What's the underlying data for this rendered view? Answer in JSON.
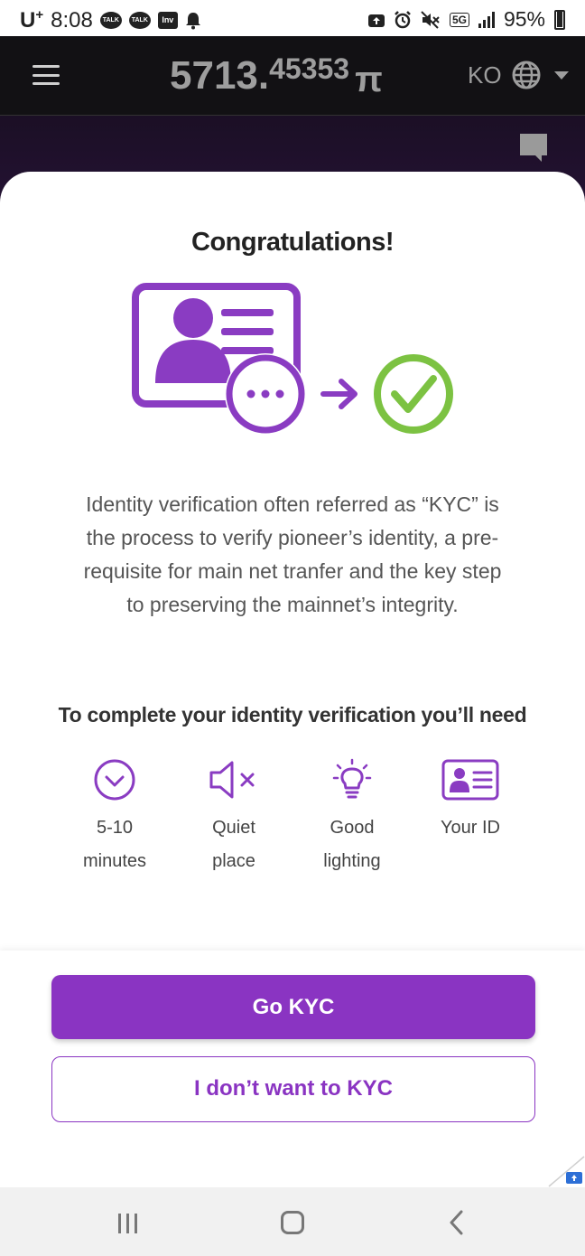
{
  "status_bar": {
    "carrier": "U",
    "carrier_sup": "+",
    "time": "8:08",
    "notif_1": "TALK",
    "notif_2": "TALK",
    "notif_3": "Inv",
    "network": "5G",
    "battery": "95%"
  },
  "header": {
    "balance_int": "5713.",
    "balance_dec": "45353",
    "currency_symbol": "π",
    "language": "KO"
  },
  "modal": {
    "title": "Congratulations!",
    "description": "Identity verification often referred as “KYC” is the process to verify pioneer’s identity, a pre-requisite for main net tranfer and the key step to preserving the mainnet’s integrity.",
    "requirements_title": "To complete your identity verification you’ll need",
    "requirements": [
      {
        "icon": "clock-icon",
        "line1": "5-10",
        "line2": "minutes"
      },
      {
        "icon": "speaker-mute-icon",
        "line1": "Quiet",
        "line2": "place"
      },
      {
        "icon": "lightbulb-icon",
        "line1": "Good",
        "line2": "lighting"
      },
      {
        "icon": "id-card-icon",
        "line1": "Your ID",
        "line2": ""
      }
    ],
    "primary_button": "Go KYC",
    "secondary_button": "I don’t want to KYC"
  },
  "colors": {
    "accent": "#8a34c2",
    "check_green": "#7cc242",
    "header_bg": "#121114"
  }
}
